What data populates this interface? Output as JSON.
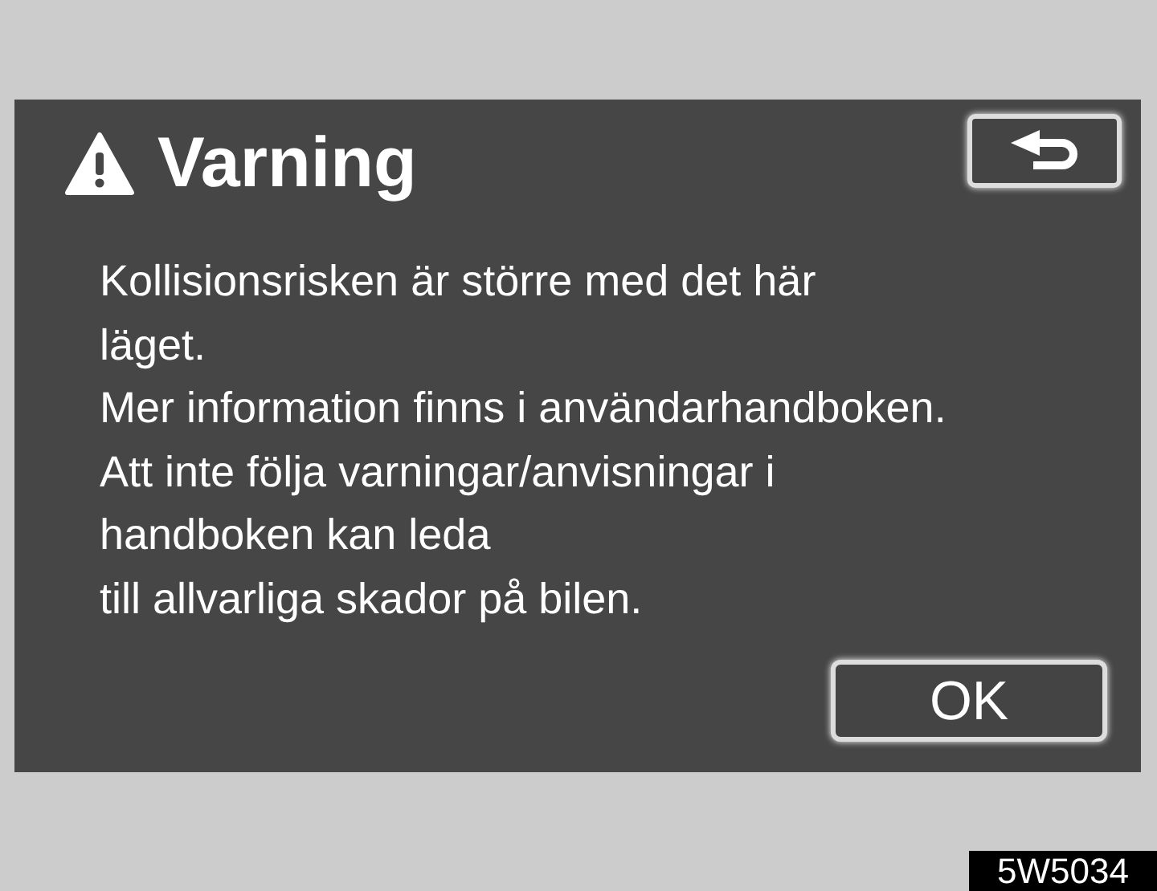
{
  "dialog": {
    "title": "Varning",
    "message_lines": [
      "Kollisionsrisken är större med det här",
      "läget.",
      "Mer information finns i användarhandboken.",
      "Att inte följa varningar/anvisningar i",
      "handboken kan leda",
      "till allvarliga skador på bilen."
    ],
    "ok_button": "OK"
  },
  "figure_code": "5W5034"
}
